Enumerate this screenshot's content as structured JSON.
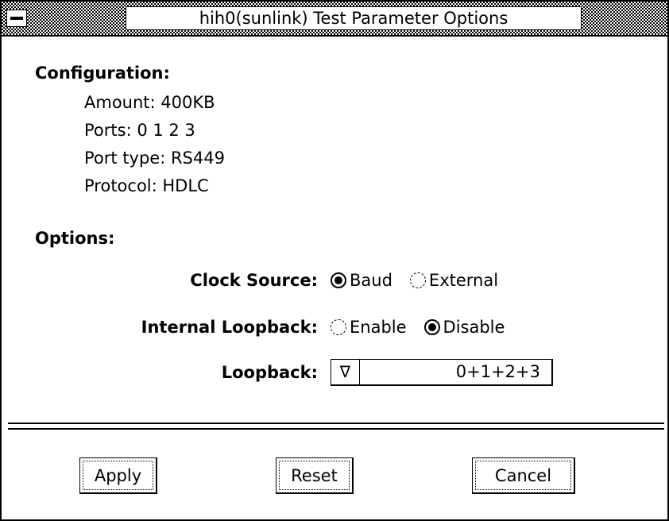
{
  "window": {
    "title": "hih0(sunlink) Test Parameter Options"
  },
  "configuration": {
    "heading": "Configuration:",
    "amount": "Amount: 400KB",
    "ports": "Ports: 0 1 2 3",
    "port_type": "Port type: RS449",
    "protocol": "Protocol: HDLC"
  },
  "options": {
    "heading": "Options:",
    "clock_source": {
      "label": "Clock Source:",
      "choices": [
        "Baud",
        "External"
      ],
      "selected": "Baud"
    },
    "internal_loopback": {
      "label": "Internal Loopback:",
      "choices": [
        "Enable",
        "Disable"
      ],
      "selected": "Disable"
    },
    "loopback": {
      "label": "Loopback:",
      "value": "0+1+2+3",
      "arrow": "∇"
    }
  },
  "buttons": {
    "apply": "Apply",
    "reset": "Reset",
    "cancel": "Cancel"
  }
}
